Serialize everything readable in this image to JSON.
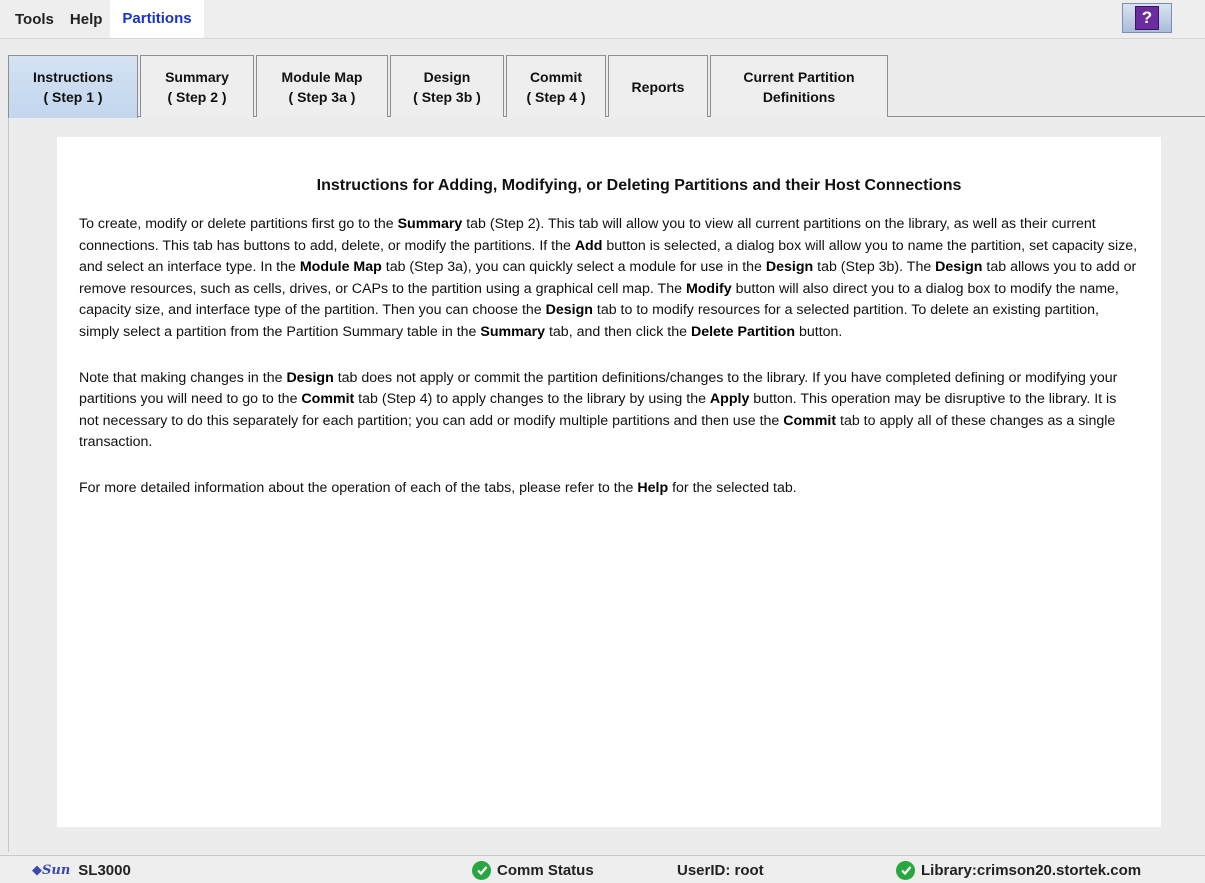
{
  "menubar": {
    "tools": "Tools",
    "help": "Help",
    "partitions": "Partitions",
    "help_icon": "?"
  },
  "tabs": [
    {
      "line1": "Instructions",
      "line2": "( Step 1 )"
    },
    {
      "line1": "Summary",
      "line2": "( Step 2 )"
    },
    {
      "line1": "Module Map",
      "line2": "( Step 3a )"
    },
    {
      "line1": "Design",
      "line2": "( Step 3b )"
    },
    {
      "line1": "Commit",
      "line2": "( Step 4 )"
    },
    {
      "line1": "Reports",
      "line2": ""
    },
    {
      "line1": "Current Partition",
      "line2": "Definitions"
    }
  ],
  "content": {
    "title": "Instructions for Adding, Modifying, or Deleting Partitions and their Host Connections",
    "p1": [
      "To create, modify or delete partitions first go to the ",
      "Summary",
      " tab (Step 2). This tab will allow you to view all current partitions on the library, as well as their current connections. This tab has buttons to add, delete, or modify the partitions. If the ",
      "Add",
      " button is selected, a dialog box will allow you to name the partition, set capacity size, and select an interface type. In the ",
      "Module Map",
      " tab (Step 3a), you can quickly select a module for use in the ",
      "Design",
      " tab (Step 3b). The ",
      "Design",
      " tab allows you to add or remove resources, such as cells, drives, or CAPs to the partition using a graphical cell map. The ",
      "Modify",
      " button will also direct you to a dialog box to modify the name, capacity size, and interface type of the partition. Then you can choose the ",
      "Design",
      " tab to to modify resources for a selected partition. To delete an existing partition, simply select a partition from the Partition Summary table in the ",
      "Summary",
      " tab, and then click the ",
      "Delete Partition",
      " button."
    ],
    "p2": [
      "Note that making changes in the ",
      "Design",
      " tab does not apply or commit the partition definitions/changes to the library. If you have completed defining or modifying your partitions you will need to go to the ",
      "Commit",
      " tab (Step 4) to apply changes to the library by using the ",
      "Apply",
      " button. This operation may be disruptive to the library. It is not necessary to do this separately for each partition; you can add or modify multiple partitions and then use the ",
      "Commit",
      " tab to apply all of these changes as a single transaction."
    ],
    "p3": [
      "For more detailed information about the operation of each of the tabs, please refer to the ",
      "Help",
      " for the selected tab."
    ]
  },
  "status": {
    "logo": "Sun",
    "model": "SL3000",
    "comm": "Comm Status",
    "user": "UserID: root",
    "library": "Library:crimson20.stortek.com"
  },
  "colors": {
    "active_menu": "#1a33cc",
    "active_tab": "#c8d9ef",
    "ok": "#2aa640"
  }
}
